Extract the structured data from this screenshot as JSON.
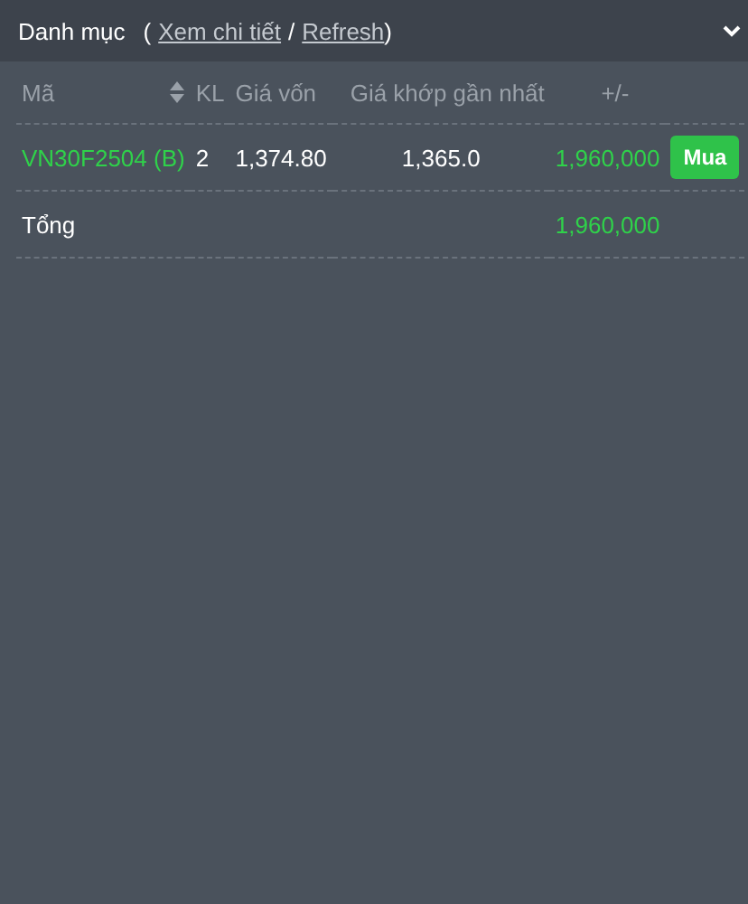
{
  "panel": {
    "title": "Danh mục",
    "paren_open": "(",
    "link_detail": "Xem chi tiết",
    "separator": "/",
    "link_refresh": "Refresh",
    "paren_close": ")",
    "expanded": true
  },
  "table": {
    "columns": [
      {
        "label": "Mã",
        "sortable": true
      },
      {
        "label": "KL",
        "sortable": false
      },
      {
        "label": "Giá vốn",
        "sortable": false
      },
      {
        "label": "Giá khớp gần nhất",
        "sortable": false
      },
      {
        "label": "+/-",
        "sortable": false
      }
    ],
    "rows": [
      {
        "symbol": "VN30F2504 (B)",
        "qty": "2",
        "cost": "1,374.80",
        "last": "1,365.0",
        "pnl": "1,960,000",
        "action": "Mua"
      }
    ],
    "total": {
      "label": "Tổng",
      "pnl": "1,960,000"
    }
  }
}
